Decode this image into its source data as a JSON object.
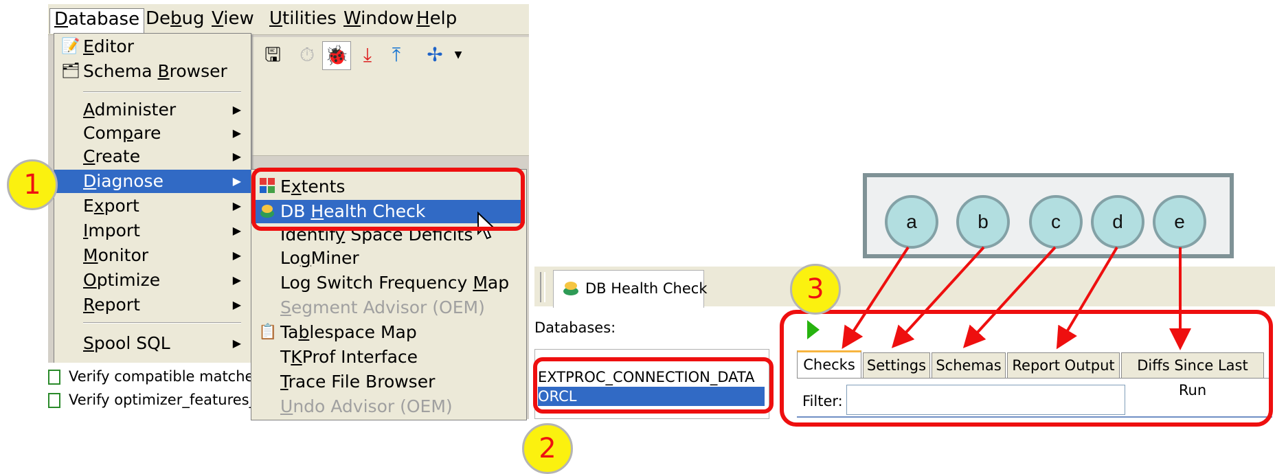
{
  "menubar": {
    "items": [
      {
        "pre": "",
        "key": "D",
        "post": "atabase"
      },
      {
        "pre": "De",
        "key": "b",
        "post": "ug"
      },
      {
        "pre": "",
        "key": "V",
        "post": "iew"
      },
      {
        "pre": "",
        "key": "U",
        "post": "tilities"
      },
      {
        "pre": "",
        "key": "W",
        "post": "indow"
      },
      {
        "pre": "",
        "key": "H",
        "post": "elp"
      }
    ]
  },
  "database_menu": {
    "items": [
      {
        "pre": "",
        "key": "E",
        "post": "ditor",
        "icon": "editor-icon",
        "submenu": false
      },
      {
        "pre": "Schema ",
        "key": "B",
        "post": "rowser",
        "icon": "schema-browser-icon",
        "submenu": false
      },
      {
        "pre": "",
        "key": "A",
        "post": "dminister",
        "submenu": true
      },
      {
        "pre": "Com",
        "key": "p",
        "post": "are",
        "submenu": true
      },
      {
        "pre": "",
        "key": "C",
        "post": "reate",
        "submenu": true
      },
      {
        "pre": "",
        "key": "D",
        "post": "iagnose",
        "submenu": true,
        "selected": true
      },
      {
        "pre": "E",
        "key": "x",
        "post": "port",
        "submenu": true
      },
      {
        "pre": "",
        "key": "I",
        "post": "mport",
        "submenu": true
      },
      {
        "pre": "",
        "key": "M",
        "post": "onitor",
        "submenu": true
      },
      {
        "pre": "",
        "key": "O",
        "post": "ptimize",
        "submenu": true
      },
      {
        "pre": "",
        "key": "R",
        "post": "eport",
        "submenu": true
      },
      {
        "pre": "",
        "key": "S",
        "post": "pool SQL",
        "submenu": true
      }
    ]
  },
  "diagnose_submenu": {
    "items": [
      {
        "pre": "E",
        "key": "x",
        "post": "tents",
        "icon": "extents-icon"
      },
      {
        "pre": "DB ",
        "key": "H",
        "post": "ealth Check",
        "icon": "db-health-check-icon",
        "selected": true
      },
      {
        "pre": "Identif",
        "key": "y",
        "post": " Space Deficits"
      },
      {
        "pre": "Lo",
        "key": "g",
        "post": "Miner"
      },
      {
        "pre": "Log Switch Frequency ",
        "key": "M",
        "post": "ap"
      },
      {
        "pre": "",
        "key": "S",
        "post": "egment Advisor (OEM)",
        "disabled": true
      },
      {
        "pre": "Ta",
        "key": "b",
        "post": "lespace Map",
        "icon": "tablespace-map-icon"
      },
      {
        "pre": "T",
        "key": "K",
        "post": "Prof Interface"
      },
      {
        "pre": "",
        "key": "T",
        "post": "race File Browser"
      },
      {
        "pre": "",
        "key": "U",
        "post": "ndo Advisor (OEM)",
        "disabled": true
      }
    ]
  },
  "background_list": {
    "items": [
      "Verify compatible matches",
      "Verify optimizer_features_e"
    ]
  },
  "health_check": {
    "window_tab": "DB Health Check",
    "databases_label": "Databases:",
    "databases": [
      "EXTPROC_CONNECTION_DATA",
      "ORCL"
    ],
    "selected_database": "ORCL",
    "tabs": [
      "Checks",
      "Settings",
      "Schemas",
      "Report Output",
      "Diffs Since Last Run"
    ],
    "active_tab": "Checks",
    "filter_label": "Filter:",
    "filter_value": ""
  },
  "annotations": {
    "steps": [
      "1",
      "2",
      "3"
    ],
    "legend": [
      "a",
      "b",
      "c",
      "d",
      "e"
    ],
    "colors": {
      "highlight": "#ee0f0f",
      "step_fill": "#fbf10f",
      "legend_fill": "#b2dee0",
      "selection": "#316ac5"
    }
  }
}
